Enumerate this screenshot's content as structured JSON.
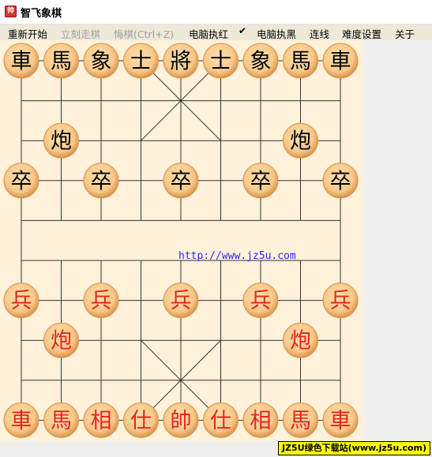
{
  "window": {
    "title": "智飞象棋",
    "icon": "chess-app-icon"
  },
  "menu": {
    "items": [
      {
        "label": "重新开始",
        "enabled": true
      },
      {
        "label": "立刻走棋",
        "enabled": false
      },
      {
        "label": "悔棋(Ctrl+Z)",
        "enabled": false
      },
      {
        "label": "电脑执红",
        "enabled": true,
        "checked": true
      },
      {
        "label": "电脑执黑",
        "enabled": true
      },
      {
        "label": "连线",
        "enabled": true
      },
      {
        "label": "难度设置",
        "enabled": true
      },
      {
        "label": "关于",
        "enabled": true
      }
    ],
    "check_glyph": "✔"
  },
  "board": {
    "files": 9,
    "ranks": 10,
    "pieces": [
      {
        "char": "車",
        "side": "black",
        "file": 0,
        "rank": 0
      },
      {
        "char": "馬",
        "side": "black",
        "file": 1,
        "rank": 0
      },
      {
        "char": "象",
        "side": "black",
        "file": 2,
        "rank": 0
      },
      {
        "char": "士",
        "side": "black",
        "file": 3,
        "rank": 0
      },
      {
        "char": "將",
        "side": "black",
        "file": 4,
        "rank": 0
      },
      {
        "char": "士",
        "side": "black",
        "file": 5,
        "rank": 0
      },
      {
        "char": "象",
        "side": "black",
        "file": 6,
        "rank": 0
      },
      {
        "char": "馬",
        "side": "black",
        "file": 7,
        "rank": 0
      },
      {
        "char": "車",
        "side": "black",
        "file": 8,
        "rank": 0
      },
      {
        "char": "炮",
        "side": "black",
        "file": 1,
        "rank": 2
      },
      {
        "char": "炮",
        "side": "black",
        "file": 7,
        "rank": 2
      },
      {
        "char": "卒",
        "side": "black",
        "file": 0,
        "rank": 3
      },
      {
        "char": "卒",
        "side": "black",
        "file": 2,
        "rank": 3
      },
      {
        "char": "卒",
        "side": "black",
        "file": 4,
        "rank": 3
      },
      {
        "char": "卒",
        "side": "black",
        "file": 6,
        "rank": 3
      },
      {
        "char": "卒",
        "side": "black",
        "file": 8,
        "rank": 3
      },
      {
        "char": "兵",
        "side": "red",
        "file": 0,
        "rank": 6
      },
      {
        "char": "兵",
        "side": "red",
        "file": 2,
        "rank": 6
      },
      {
        "char": "兵",
        "side": "red",
        "file": 4,
        "rank": 6
      },
      {
        "char": "兵",
        "side": "red",
        "file": 6,
        "rank": 6
      },
      {
        "char": "兵",
        "side": "red",
        "file": 8,
        "rank": 6
      },
      {
        "char": "炮",
        "side": "red",
        "file": 1,
        "rank": 7
      },
      {
        "char": "炮",
        "side": "red",
        "file": 7,
        "rank": 7
      },
      {
        "char": "車",
        "side": "red",
        "file": 0,
        "rank": 9
      },
      {
        "char": "馬",
        "side": "red",
        "file": 1,
        "rank": 9
      },
      {
        "char": "相",
        "side": "red",
        "file": 2,
        "rank": 9
      },
      {
        "char": "仕",
        "side": "red",
        "file": 3,
        "rank": 9
      },
      {
        "char": "帥",
        "side": "red",
        "file": 4,
        "rank": 9
      },
      {
        "char": "仕",
        "side": "red",
        "file": 5,
        "rank": 9
      },
      {
        "char": "相",
        "side": "red",
        "file": 6,
        "rank": 9
      },
      {
        "char": "馬",
        "side": "red",
        "file": 7,
        "rank": 9
      },
      {
        "char": "車",
        "side": "red",
        "file": 8,
        "rank": 9
      }
    ],
    "colors": {
      "background": "#fff1da",
      "line": "#333333",
      "piece_fill": "#f7c889",
      "piece_edge": "#d9924a",
      "black_text": "#000000",
      "red_text": "#e8231a"
    }
  },
  "watermark": "http://www.jz5u.com",
  "footer": "JZ5U绿色下载站(www.jz5u.com)"
}
